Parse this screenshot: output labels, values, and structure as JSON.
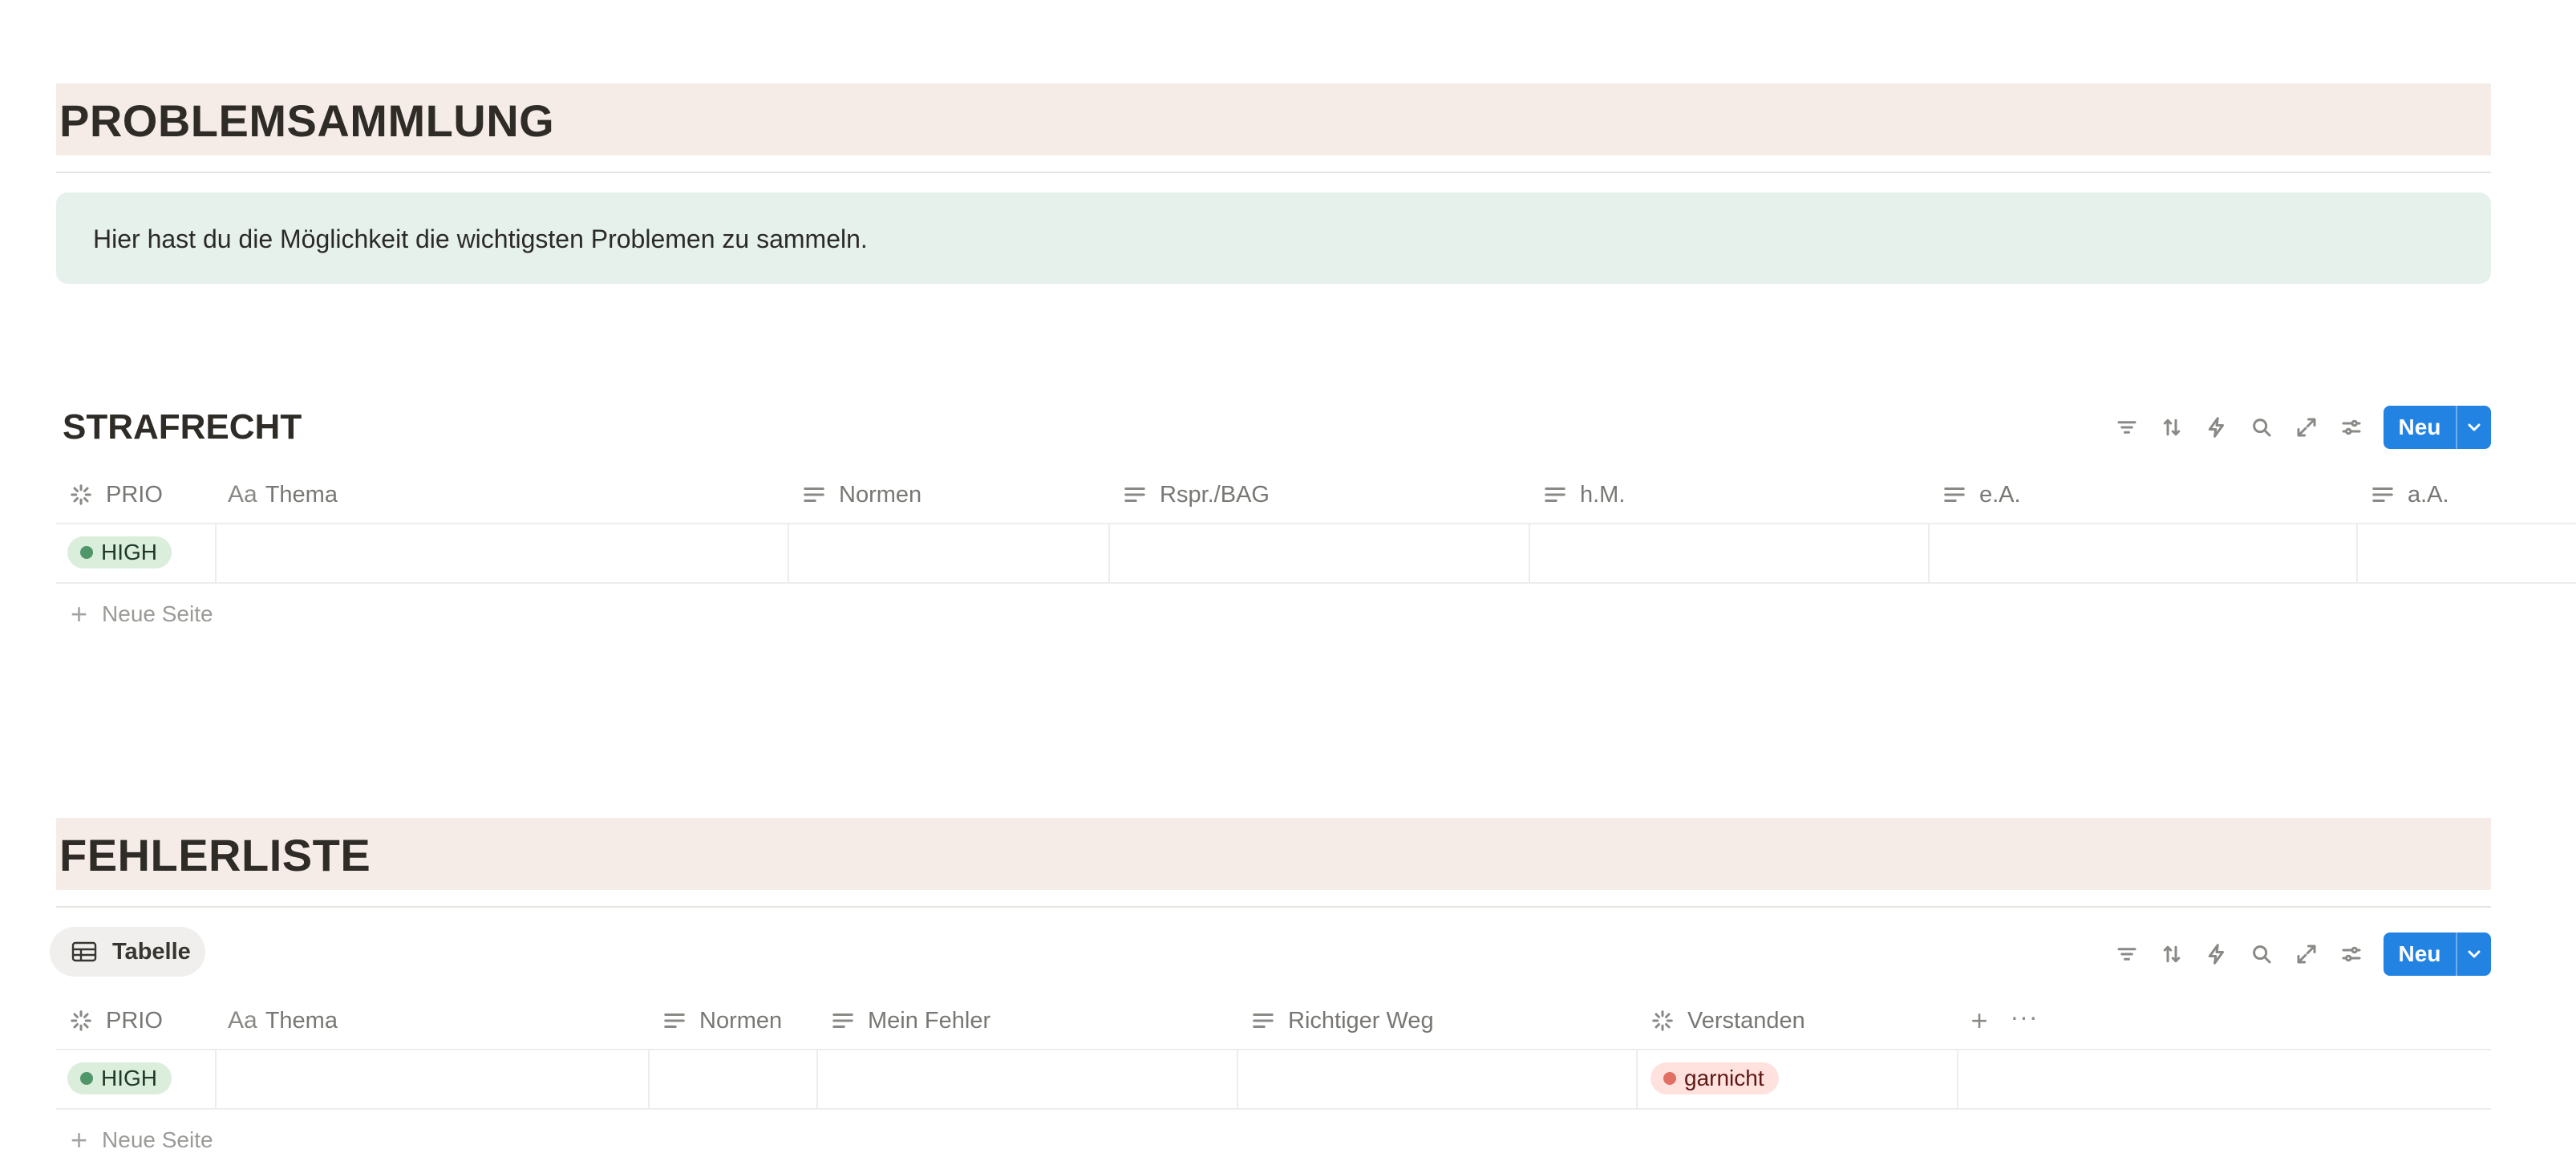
{
  "section1": {
    "heading": "PROBLEMSAMMLUNG",
    "callout_text": "Hier hast du die Möglichkeit die wichtigsten Problemen zu sammeln."
  },
  "strafrecht": {
    "title": "STRAFRECHT",
    "new_button_label": "Neu",
    "toolbar_icons": [
      "filter-icon",
      "sort-icon",
      "automation-icon",
      "search-icon",
      "expand-icon",
      "settings-icon"
    ],
    "columns": [
      {
        "label": "PRIO",
        "icon": "status-icon"
      },
      {
        "label": "Thema",
        "icon": "title-icon"
      },
      {
        "label": "Normen",
        "icon": "text-icon"
      },
      {
        "label": "Rspr./BAG",
        "icon": "text-icon"
      },
      {
        "label": "h.M.",
        "icon": "text-icon"
      },
      {
        "label": "e.A.",
        "icon": "text-icon"
      },
      {
        "label": "a.A.",
        "icon": "text-icon"
      }
    ],
    "rows": [
      {
        "prio": "HIGH"
      }
    ],
    "new_row_label": "Neue Seite"
  },
  "fehlerliste": {
    "heading": "FEHLERLISTE",
    "view_tab_label": "Tabelle",
    "new_button_label": "Neu",
    "columns": [
      {
        "label": "PRIO",
        "icon": "status-icon"
      },
      {
        "label": "Thema",
        "icon": "title-icon"
      },
      {
        "label": "Normen",
        "icon": "text-icon"
      },
      {
        "label": "Mein Fehler",
        "icon": "text-icon"
      },
      {
        "label": "Richtiger Weg",
        "icon": "text-icon"
      },
      {
        "label": "Verstanden",
        "icon": "status-icon"
      }
    ],
    "rows": [
      {
        "prio": "HIGH",
        "verstanden": "garnicht"
      }
    ],
    "new_row_label": "Neue Seite"
  },
  "colors": {
    "heading_band": "#f6ece7",
    "callout_bg": "#e7f1ec",
    "accent_blue": "#2383e2",
    "pill_green_bg": "#dbeddb",
    "pill_green_dot": "#4f9768",
    "pill_red_bg": "#ffe2dd",
    "pill_red_dot": "#e16f64"
  }
}
